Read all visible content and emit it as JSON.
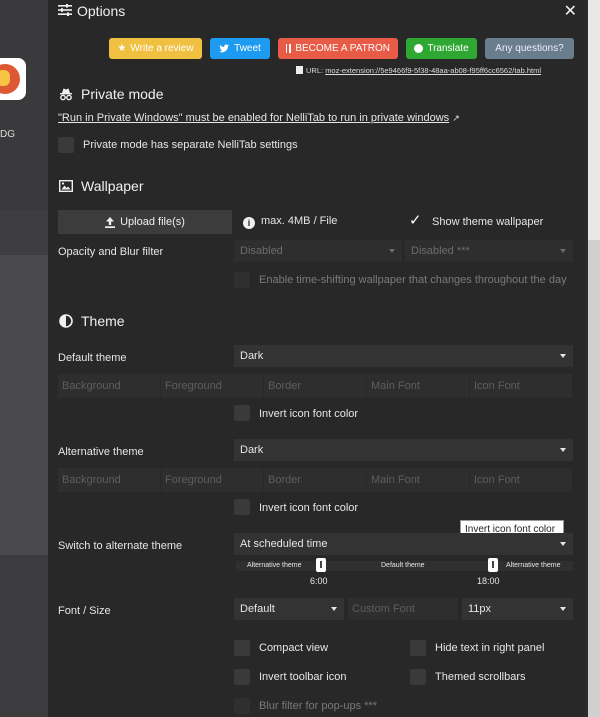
{
  "background": {
    "app_text": "DG"
  },
  "header": {
    "title": "Options",
    "close_glyph": "✕"
  },
  "action_buttons": {
    "review": "Write a review",
    "tweet": "Tweet",
    "patron": "BECOME A PATRON",
    "translate": "Translate",
    "questions": "Any questions?"
  },
  "url_line": {
    "prefix": "URL:",
    "url": "moz-extension://5e9466f9-5f38-48aa-ab08-f95ff6cc6562/tab.html"
  },
  "private_mode": {
    "title": "Private mode",
    "note": "\"Run in Private Windows\" must be enabled for NelliTab to run in private windows",
    "separate_settings": "Private mode has separate NelliTab settings"
  },
  "wallpaper": {
    "title": "Wallpaper",
    "upload_label": "Upload file(s)",
    "max_label": "max. 4MB / File",
    "show_theme_wallpaper": "Show theme wallpaper",
    "opacity_label": "Opacity and Blur filter",
    "opacity_select": "Disabled",
    "blur_select": "Disabled ***",
    "time_shift": "Enable time-shifting wallpaper that changes throughout the day"
  },
  "theme": {
    "title": "Theme",
    "default_label": "Default theme",
    "default_value": "Dark",
    "alt_label": "Alternative theme",
    "alt_value": "Dark",
    "placeholders": [
      "Background",
      "Foreground",
      "Border",
      "Main Font",
      "Icon Font"
    ],
    "invert_icon": "Invert icon font color",
    "switch_label": "Switch to alternate theme",
    "switch_value": "At scheduled time",
    "tooltip": "Invert icon font color",
    "slider": {
      "left": "Alternative theme",
      "middle": "Default theme",
      "right": "Alternative theme",
      "start_time": "6:00",
      "end_time": "18:00"
    },
    "font_label": "Font / Size",
    "font_value": "Default",
    "custom_font_placeholder": "Custom Font",
    "size_value": "11px",
    "compact_view": "Compact view",
    "hide_text": "Hide text in right panel",
    "invert_toolbar": "Invert toolbar icon",
    "themed_scrollbars": "Themed scrollbars",
    "blur_popups": "Blur filter for pop-ups ***"
  }
}
